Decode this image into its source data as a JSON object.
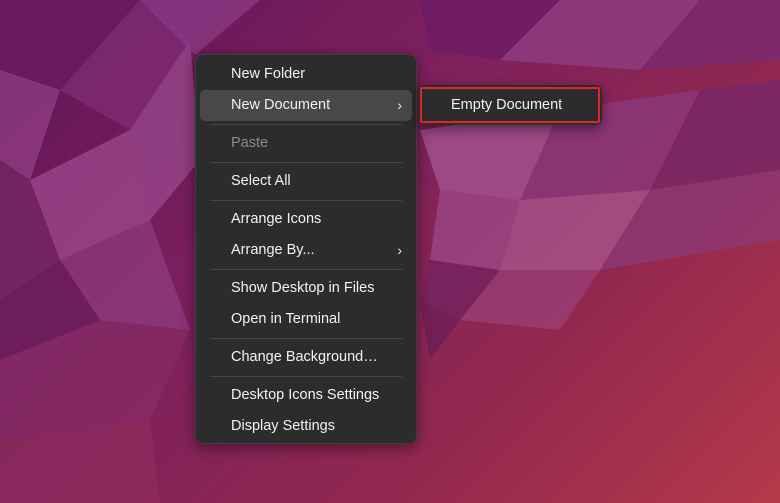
{
  "desktop": {
    "context_menu": {
      "items": [
        {
          "label": "New Folder"
        },
        {
          "label": "New Document",
          "chevron": "›"
        },
        {
          "label": "Paste"
        },
        {
          "label": "Select All"
        },
        {
          "label": "Arrange Icons"
        },
        {
          "label": "Arrange By...",
          "chevron": "›"
        },
        {
          "label": "Show Desktop in Files"
        },
        {
          "label": "Open in Terminal"
        },
        {
          "label": "Change Background…"
        },
        {
          "label": "Desktop Icons Settings"
        },
        {
          "label": "Display Settings"
        }
      ]
    },
    "submenu": {
      "items": [
        {
          "label": "Empty Document"
        }
      ]
    }
  },
  "colors": {
    "menu_bg": "#2c2c2c",
    "menu_active": "#484848",
    "highlight_border": "#e0242a",
    "text": "#f2f2f2",
    "text_disabled": "#8a8a8a"
  }
}
